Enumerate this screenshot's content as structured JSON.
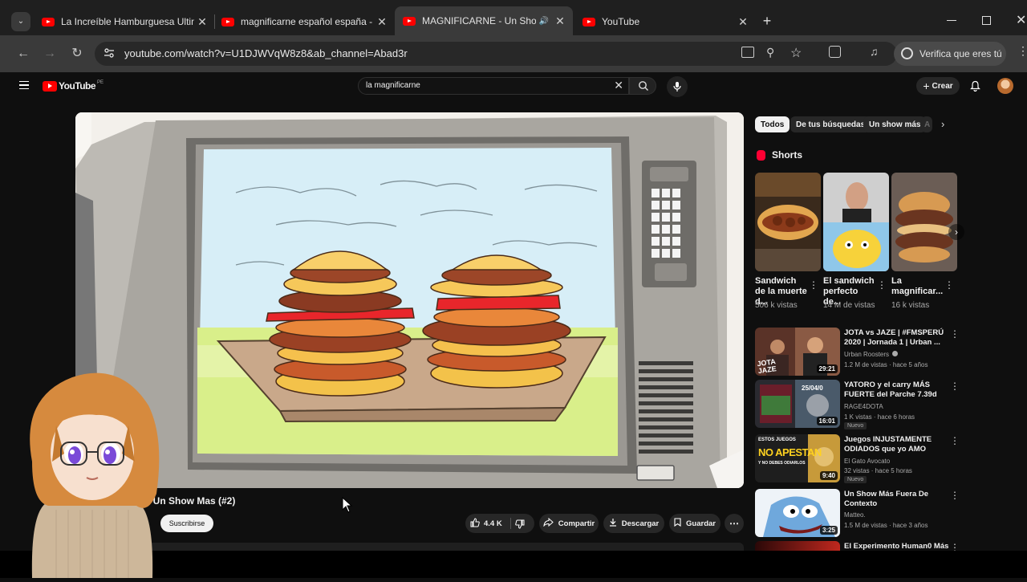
{
  "browser": {
    "tabs": [
      {
        "title": "La Increíble Hamburguesa Ultim",
        "close": "✕"
      },
      {
        "title": "magnificarne español españa -",
        "close": "✕"
      },
      {
        "title": "MAGNIFICARNE - Un Show",
        "close": "✕",
        "active": true,
        "audio": "🔊"
      },
      {
        "title": "YouTube",
        "close": "✕"
      }
    ],
    "new_tab": "+",
    "url": "youtube.com/watch?v=U1DJWVqW8z8&ab_channel=Abad3r",
    "verify_label": "Verifica que eres tú"
  },
  "youtube": {
    "logo_text": "YouTube",
    "region": "PE",
    "search_value": "la magnificarne",
    "create_label": "Crear"
  },
  "chips": [
    "Todos",
    "De tus búsquedas",
    "Un show más",
    "A"
  ],
  "shorts": {
    "heading": "Shorts",
    "items": [
      {
        "title": "Sandwich de la muerte d...",
        "views": "506 k vistas"
      },
      {
        "title": "El sandwich perfecto de...",
        "views": "14 M de vistas"
      },
      {
        "title": "La magnificar...",
        "views": "16 k vistas"
      }
    ]
  },
  "recommended": [
    {
      "title": "JOTA vs JAZE | #FMSPERÚ 2020 | Jornada 1 | Urban ...",
      "channel": "Urban Roosters",
      "meta": "1.2 M de vistas · hace 5 años",
      "duration": "29:21",
      "thumb_text": "JOTA JAZE",
      "badge": ""
    },
    {
      "title": "YATORO y el carry MÁS FUERTE del Parche 7.39d",
      "channel": "RAGE4DOTA",
      "meta": "1 K vistas · hace 6 horas",
      "duration": "16:01",
      "thumb_text": "25/04/0",
      "badge": "Nuevo"
    },
    {
      "title": "Juegos INJUSTAMENTE ODIADOS que yo AMO",
      "channel": "El Gato Avocato",
      "meta": "32 vistas · hace 5 horas",
      "duration": "9:40",
      "thumb_text": "NO APESTAN",
      "thumb_top": "ESTOS JUEGOS",
      "thumb_bottom": "Y NO DEBES ODIARLOS",
      "badge": "Nuevo"
    },
    {
      "title": "Un Show Más Fuera De Contexto",
      "channel": "Matteo.",
      "meta": "1.5 M de vistas · hace 3 años",
      "duration": "3:25",
      "badge": ""
    },
    {
      "title": "El Experimento Human0 Más",
      "channel": "",
      "meta": "",
      "duration": "",
      "badge": ""
    }
  ],
  "video": {
    "title": "ICARNE - Un Show Mas (#2)",
    "subscribe_label": "Suscribirse",
    "likes": "4.4 K",
    "share_label": "Compartir",
    "download_label": "Descargar",
    "save_label": "Guardar"
  }
}
